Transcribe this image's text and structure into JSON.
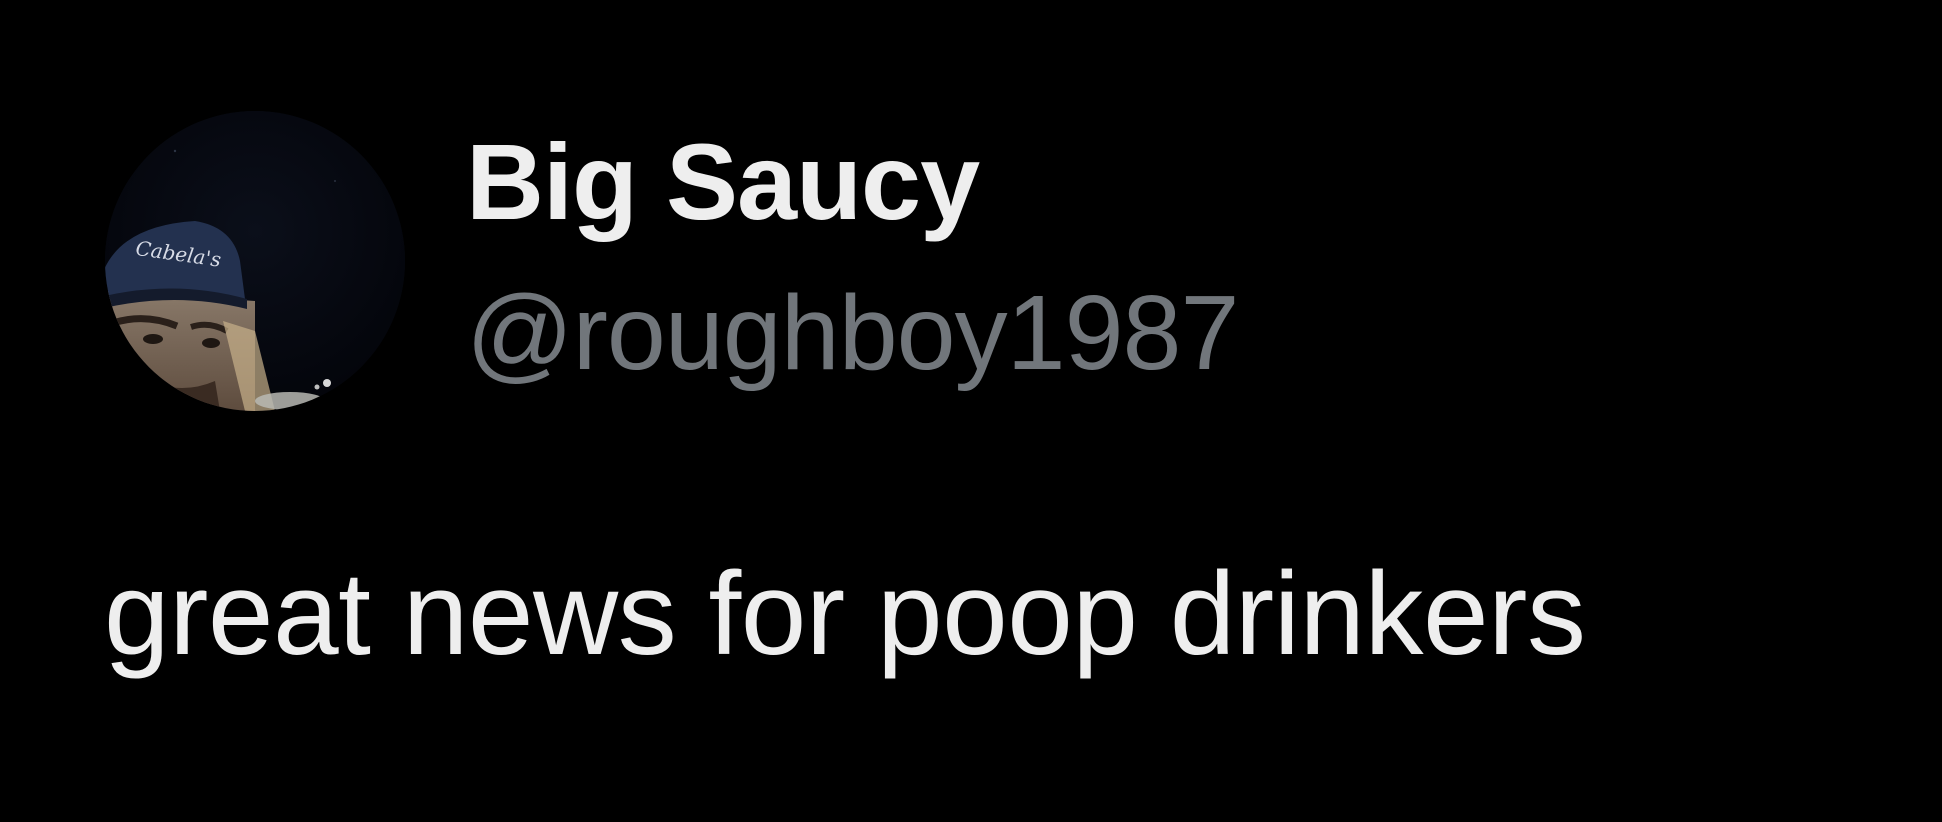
{
  "theme": {
    "background": "#000000",
    "primary_text": "#eeeeee",
    "secondary_text": "#71767b"
  },
  "author": {
    "display_name": "Big Saucy",
    "handle": "@roughboy1987",
    "avatar_icon": "profile-photo",
    "avatar_cap_text": "Cabela's"
  },
  "tweet": {
    "text": "great news for poop drinkers"
  }
}
